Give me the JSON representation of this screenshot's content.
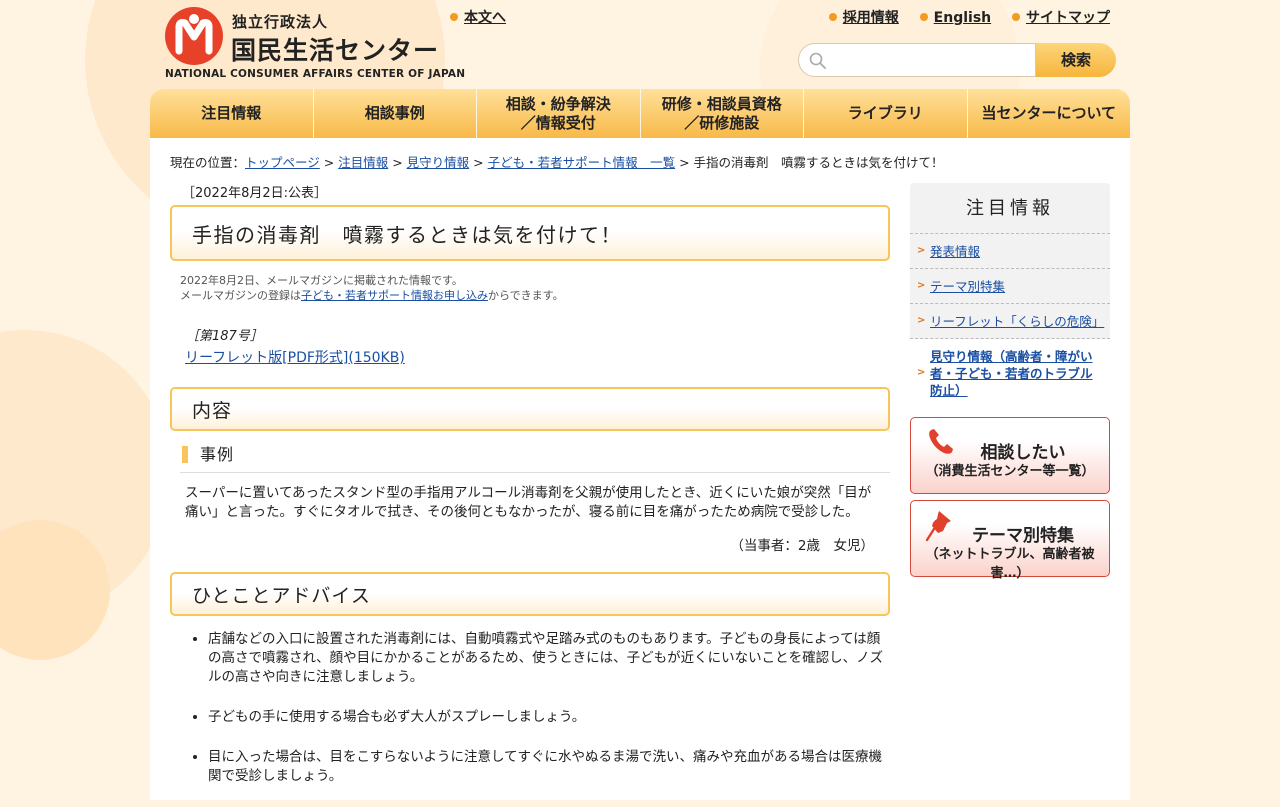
{
  "header": {
    "logo_small": "独立行政法人",
    "logo_big": "国民生活センター",
    "logo_en": "NATIONAL CONSUMER AFFAIRS CENTER OF JAPAN",
    "skip_link": "本文へ",
    "top_links": [
      "採用情報",
      "English",
      "サイトマップ"
    ],
    "search_placeholder": "",
    "search_button": "検索"
  },
  "nav": [
    [
      "注目情報"
    ],
    [
      "相談事例"
    ],
    [
      "相談・紛争解決",
      "／情報受付"
    ],
    [
      "研修・相談員資格",
      "／研修施設"
    ],
    [
      "ライブラリ"
    ],
    [
      "当センターについて"
    ]
  ],
  "breadcrumb": {
    "prefix": "現在の位置：",
    "links": [
      "トップページ",
      "注目情報",
      "見守り情報",
      "子ども・若者サポート情報　一覧"
    ],
    "separator": " > ",
    "current": "手指の消毒剤　噴霧するときは気を付けて！"
  },
  "article": {
    "date": "［2022年8月2日:公表］",
    "title": "手指の消毒剤　噴霧するときは気を付けて！",
    "note_line1": "2022年8月2日、メールマガジンに掲載された情報です。",
    "note_line2_pre": "メールマガジンの登録は",
    "note_link": "子ども・若者サポート情報お申し込み",
    "note_line2_post": "からできます。",
    "issue": "［第187号］",
    "leaflet": "リーフレット版[PDF形式](150KB)",
    "section_content": "内容",
    "case_heading": "事例",
    "case_text": "スーパーに置いてあったスタンド型の手指用アルコール消毒剤を父親が使用したとき、近くにいた娘が突然「目が痛い」と言った。すぐにタオルで拭き、その後何ともなかったが、寝る前に目を痛がったため病院で受診した。",
    "case_party": "（当事者：2歳　女児）",
    "section_advice": "ひとことアドバイス",
    "advice": [
      "店舗などの入口に設置された消毒剤には、自動噴霧式や足踏み式のものもあります。子どもの身長によっては顔の高さで噴霧され、顔や目にかかることがあるため、使うときには、子どもが近くにいないことを確認し、ノズルの高さや向きに注意しましょう。",
      "子どもの手に使用する場合も必ず大人がスプレーしましょう。",
      "目に入った場合は、目をこすらないように注意してすぐに水やぬるま湯で洗い、痛みや充血がある場合は医療機関で受診しましょう。"
    ]
  },
  "sidebar": {
    "heading": "注目情報",
    "items": [
      "発表情報",
      "テーマ別特集",
      "リーフレット「くらしの危険」",
      "見守り情報（高齢者・障がい者・子ども・若者のトラブル防止）"
    ],
    "consult_title": "相談したい",
    "consult_sub": "（消費生活センター等一覧）",
    "theme_title": "テーマ別特集",
    "theme_sub": "（ネットトラブル、高齢者被害…）"
  },
  "colors": {
    "accent_orange": "#f8b948",
    "border_orange": "#f8c55a",
    "logo_red": "#e8412a",
    "link_blue": "#1a4fa3"
  }
}
